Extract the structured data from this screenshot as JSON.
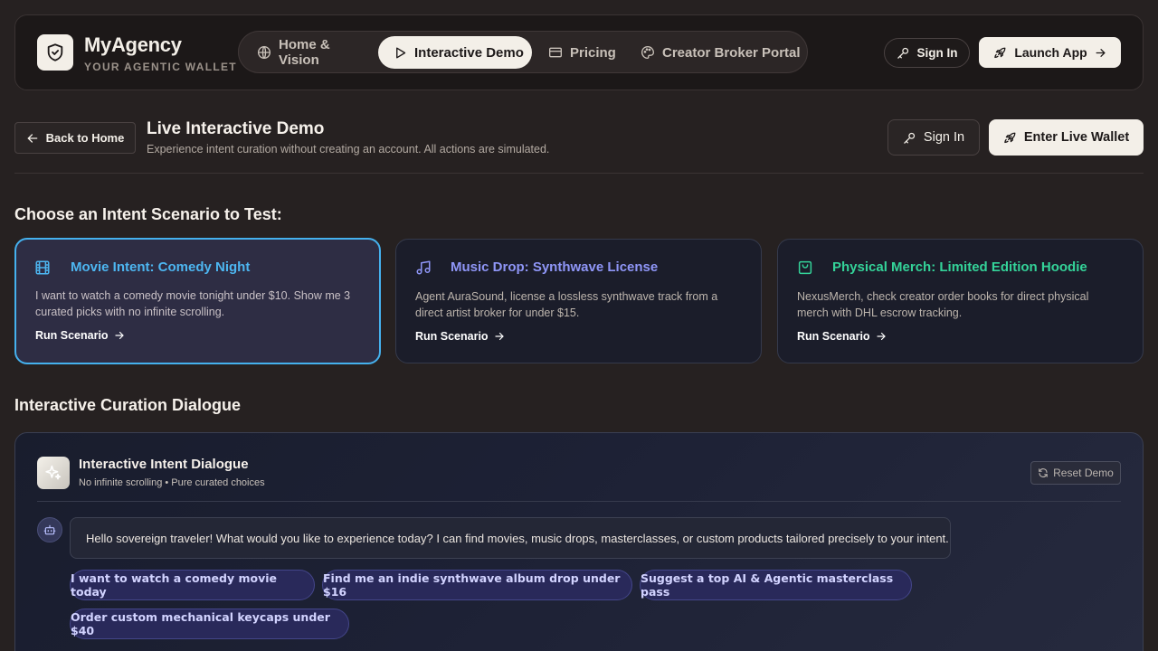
{
  "app": {
    "name": "MyAgency",
    "tagline": "YOUR AGENTIC WALLET"
  },
  "nav": {
    "tabs": [
      {
        "label": "Home & Vision",
        "icon": "globe-icon",
        "active": false
      },
      {
        "label": "Interactive Demo",
        "icon": "play-icon",
        "active": true
      },
      {
        "label": "Pricing",
        "icon": "credit-card-icon",
        "active": false
      },
      {
        "label": "Creator Broker Portal",
        "icon": "palette-icon",
        "active": false
      }
    ],
    "sign_in": "Sign In",
    "launch_app": "Launch App"
  },
  "page": {
    "back_label": "Back to Home",
    "title": "Live Interactive Demo",
    "subtitle": "Experience intent curation without creating an account. All actions are simulated.",
    "sign_in": "Sign In",
    "enter_wallet": "Enter Live Wallet"
  },
  "scenarios": {
    "heading": "Choose an Intent Scenario to Test:",
    "run_label": "Run Scenario",
    "items": [
      {
        "title": "Movie Intent: Comedy Night",
        "description": "I want to watch a comedy movie tonight under $10. Show me 3 curated picks with no infinite scrolling.",
        "icon": "film-icon",
        "color": "#4db6f1",
        "selected": true
      },
      {
        "title": "Music Drop: Synthwave License",
        "description": "Agent AuraSound, license a lossless synthwave track from a direct artist broker for under $15.",
        "icon": "music-note-icon",
        "color": "#8f96f7",
        "selected": false
      },
      {
        "title": "Physical Merch: Limited Edition Hoodie",
        "description": "NexusMerch, check creator order books for direct physical merch with DHL escrow tracking.",
        "icon": "shopping-bag-icon",
        "color": "#34d399",
        "selected": false
      }
    ]
  },
  "dialogue": {
    "heading": "Interactive Curation Dialogue",
    "title": "Interactive Intent Dialogue",
    "subtitle": "No infinite scrolling • Pure curated choices",
    "reset_label": "Reset Demo",
    "bot_message": "Hello sovereign traveler! What would you like to experience today? I can find movies, music drops, masterclasses, or custom products tailored precisely to your intent.",
    "suggestions": [
      "I want to watch a comedy movie today",
      "Find me an indie synthwave album drop under $16",
      "Suggest a top AI & Agentic masterclass pass",
      "Order custom mechanical keycaps under $40"
    ]
  },
  "colors": {
    "background": "#262121",
    "accent_blue": "#45b1ee",
    "chip_text": "#d2d3ff"
  }
}
